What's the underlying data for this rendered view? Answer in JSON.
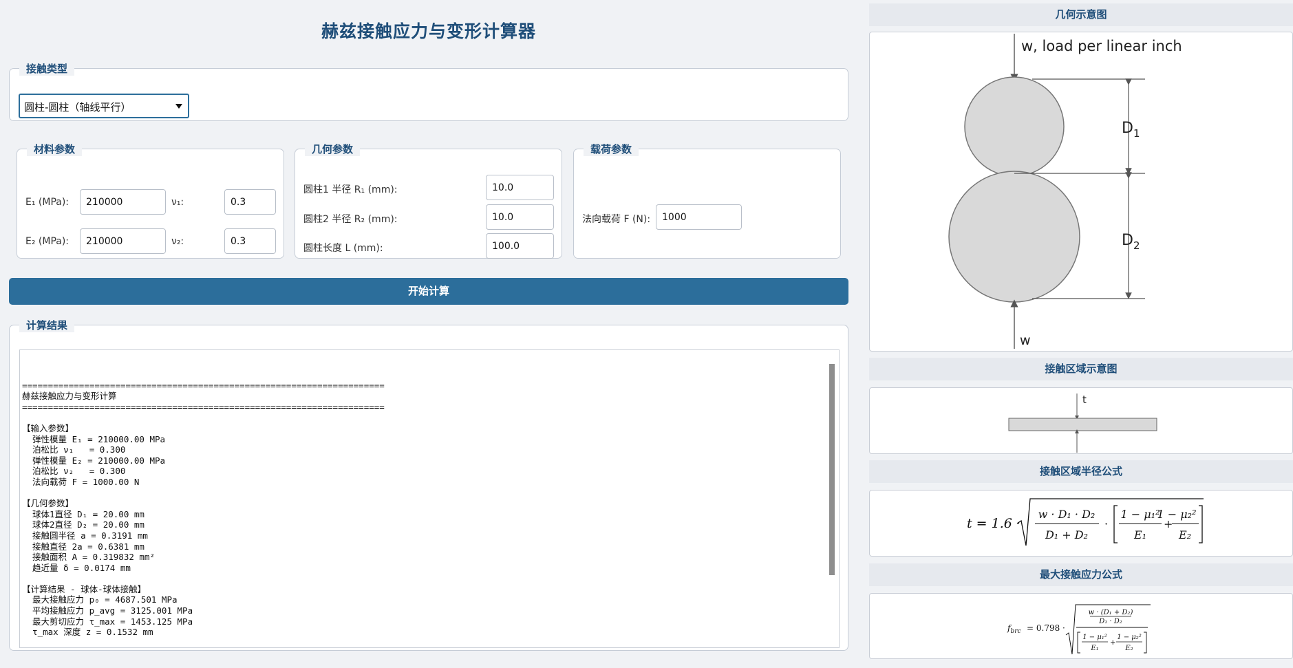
{
  "app": {
    "title": "赫兹接触应力与变形计算器"
  },
  "contact_type": {
    "group_title": "接触类型",
    "selected": "圆柱-圆柱（轴线平行）"
  },
  "material": {
    "group_title": "材料参数",
    "e1_label": "E₁ (MPa):",
    "e1_value": "210000",
    "nu1_label": "ν₁:",
    "nu1_value": "0.3",
    "e2_label": "E₂ (MPa):",
    "e2_value": "210000",
    "nu2_label": "ν₂:",
    "nu2_value": "0.3"
  },
  "geometry": {
    "group_title": "几何参数",
    "r1_label": "圆柱1 半径 R₁ (mm):",
    "r1_value": "10.0",
    "r2_label": "圆柱2 半径 R₂ (mm):",
    "r2_value": "10.0",
    "l_label": "圆柱长度 L (mm):",
    "l_value": "100.0"
  },
  "load": {
    "group_title": "载荷参数",
    "f_label": "法向载荷 F (N):",
    "f_value": "1000"
  },
  "actions": {
    "calculate_label": "开始计算"
  },
  "results": {
    "group_title": "计算结果",
    "lines": [
      "======================================================================",
      "赫兹接触应力与变形计算",
      "======================================================================",
      "",
      "【输入参数】",
      "  弹性模量 E₁ = 210000.00 MPa",
      "  泊松比 ν₁   = 0.300",
      "  弹性模量 E₂ = 210000.00 MPa",
      "  泊松比 ν₂   = 0.300",
      "  法向载荷 F = 1000.00 N",
      "",
      "【几何参数】",
      "  球体1直径 D₁ = 20.00 mm",
      "  球体2直径 D₂ = 20.00 mm",
      "  接触圆半径 a = 0.3191 mm",
      "  接触直径 2a = 0.6381 mm",
      "  接触面积 A = 0.319832 mm²",
      "  趋近量 δ = 0.0174 mm",
      "",
      "【计算结果 - 球体-球体接触】",
      "  最大接触应力 p₀ = 4687.501 MPa",
      "  平均接触应力 p_avg = 3125.001 MPa",
      "  最大剪切应力 τ_max = 1453.125 MPa",
      "  τ_max 深度 z = 0.1532 mm"
    ]
  },
  "right_panel": {
    "geometry_title": "几何示意图",
    "contact_area_title": "接触区域示意图",
    "radius_formula_title": "接触区域半径公式",
    "stress_formula_title": "最大接触应力公式",
    "diagram": {
      "load_label": "w, load per linear inch",
      "bottom_label": "w",
      "d1_label": "D",
      "d1_sub": "1",
      "d2_label": "D",
      "d2_sub": "2",
      "t_label": "t"
    },
    "formula1": {
      "lhs": "t = 1.6 ·",
      "num": "w · D₁ · D₂",
      "den": "D₁ + D₂",
      "dot": "·",
      "t1_num": "1 − μ₁²",
      "t1_den": "E₁",
      "plus": "+",
      "t2_num": "1 − μ₂²",
      "t2_den": "E₂"
    },
    "formula2": {
      "lhs": "f",
      "lhs_sub": "brc",
      "coef": "= 0.798 ·",
      "top_num": "w · (D₁ + D₂)",
      "top_den": "D₁ · D₂",
      "t1_num": "1 − μ₁²",
      "t1_den": "E₁",
      "plus": "+",
      "t2_num": "1 − μ₂²",
      "t2_den": "E₂"
    }
  }
}
